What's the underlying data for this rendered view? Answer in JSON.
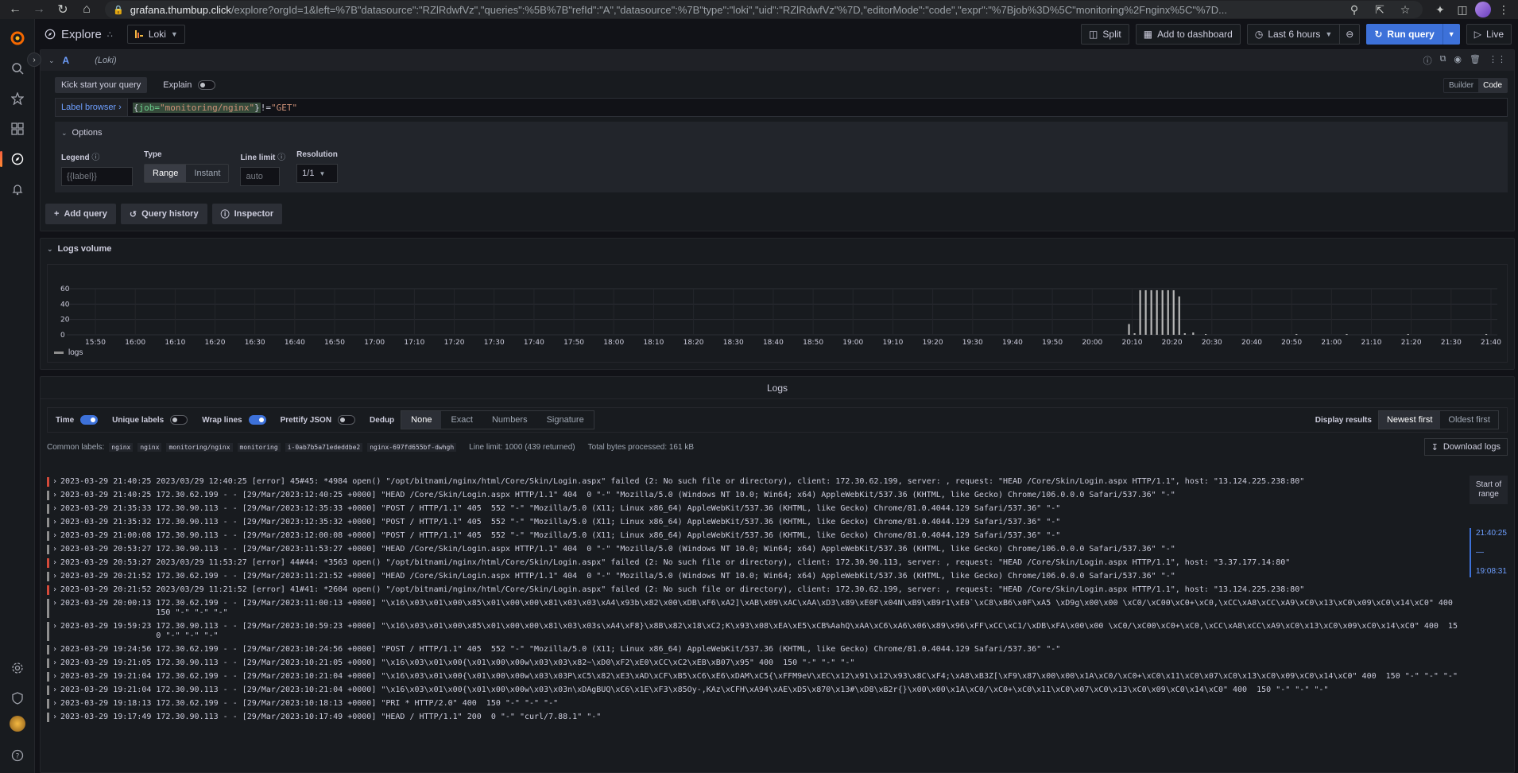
{
  "browser": {
    "url_domain": "grafana.thumbup.click",
    "url_path": "/explore?orgId=1&left=%7B\"datasource\":\"RZlRdwfVz\",\"queries\":%5B%7B\"refId\":\"A\",\"datasource\":%7B\"type\":\"loki\",\"uid\":\"RZlRdwfVz\"%7D,\"editorMode\":\"code\",\"expr\":\"%7Bjob%3D%5C\"monitoring%2Fnginx%5C\"%7D..."
  },
  "topbar": {
    "title": "Explore",
    "datasource": "Loki",
    "split": "Split",
    "add_to_dashboard": "Add to dashboard",
    "time_range": "Last 6 hours",
    "run_query": "Run query",
    "live": "Live"
  },
  "query": {
    "ref_id": "A",
    "ds_label": "(Loki)",
    "kick_start": "Kick start your query",
    "explain": "Explain",
    "builder": "Builder",
    "code": "Code",
    "label_browser": "Label browser ›",
    "expr_key": "job=",
    "expr_value": "\"monitoring/nginx\"",
    "expr_filter_op": " !=",
    "expr_filter_val": "\"GET\"",
    "options": {
      "title": "Options",
      "legend_label": "Legend",
      "legend_placeholder": "{{label}}",
      "type_label": "Type",
      "type_range": "Range",
      "type_instant": "Instant",
      "line_limit_label": "Line limit",
      "line_limit_placeholder": "auto",
      "resolution_label": "Resolution",
      "resolution_value": "1/1"
    },
    "add_query": "Add query",
    "query_history": "Query history",
    "inspector": "Inspector"
  },
  "logs_volume": {
    "title": "Logs volume",
    "legend": "logs"
  },
  "chart_data": {
    "type": "bar",
    "title": "",
    "xlabel": "",
    "ylabel": "",
    "ylim": [
      0,
      60
    ],
    "y_ticks": [
      "0",
      "20",
      "40",
      "60"
    ],
    "x_ticks": [
      "15:50",
      "16:00",
      "16:10",
      "16:20",
      "16:30",
      "16:40",
      "16:50",
      "17:00",
      "17:10",
      "17:20",
      "17:30",
      "17:40",
      "17:50",
      "18:00",
      "18:10",
      "18:20",
      "18:30",
      "18:40",
      "18:50",
      "19:00",
      "19:10",
      "19:20",
      "19:30",
      "19:40",
      "19:50",
      "20:00",
      "20:10",
      "20:20",
      "20:30",
      "20:40",
      "20:50",
      "21:00",
      "21:10",
      "21:20",
      "21:30",
      "21:40"
    ],
    "series": [
      {
        "name": "logs",
        "x": [
          0.74,
          0.744,
          0.748,
          0.752,
          0.756,
          0.76,
          0.764,
          0.768,
          0.772,
          0.776,
          0.78,
          0.786,
          0.795,
          0.86,
          0.896,
          0.94,
          0.996,
          1.015,
          1.026
        ],
        "values": [
          14,
          2,
          58,
          58,
          58,
          58,
          58,
          58,
          58,
          50,
          2,
          3,
          1,
          1,
          1,
          1,
          1,
          1,
          1
        ]
      }
    ]
  },
  "logs": {
    "title": "Logs",
    "opt_time": "Time",
    "opt_unique": "Unique labels",
    "opt_wrap": "Wrap lines",
    "opt_prettify": "Prettify JSON",
    "dedup_label": "Dedup",
    "dedup_none": "None",
    "dedup_exact": "Exact",
    "dedup_numbers": "Numbers",
    "dedup_signature": "Signature",
    "display_results": "Display results",
    "newest_first": "Newest first",
    "oldest_first": "Oldest first",
    "common_labels_label": "Common labels:",
    "common_labels": [
      "nginx",
      "nginx",
      "monitoring/nginx",
      "monitoring",
      "i-0ab7b5a71ededdbe2",
      "nginx-697fd655bf-dwhgh"
    ],
    "line_limit_text": "Line limit:  1000 (439 returned)",
    "bytes_text": "Total bytes processed:  161 kB",
    "download": "Download logs",
    "start_of_range": "Start of range",
    "range_top": "21:40:25",
    "range_sep": "—",
    "range_bottom": "19:08:31",
    "lines": [
      {
        "level": "err",
        "ts": "2023-03-29 21:40:25",
        "msg": "2023/03/29 12:40:25 [error] 45#45: *4984 open() \"/opt/bitnami/nginx/html/Core/Skin/Login.aspx\" failed (2: No such file or directory), client: 172.30.62.199, server: , request: \"HEAD /Core/Skin/Login.aspx HTTP/1.1\", host: \"13.124.225.238:80\""
      },
      {
        "level": "info",
        "ts": "2023-03-29 21:40:25",
        "msg": "172.30.62.199 - - [29/Mar/2023:12:40:25 +0000] \"HEAD /Core/Skin/Login.aspx HTTP/1.1\" 404  0 \"-\" \"Mozilla/5.0 (Windows NT 10.0; Win64; x64) AppleWebKit/537.36 (KHTML, like Gecko) Chrome/106.0.0.0 Safari/537.36\" \"-\""
      },
      {
        "level": "info",
        "ts": "2023-03-29 21:35:33",
        "msg": "172.30.90.113 - - [29/Mar/2023:12:35:33 +0000] \"POST / HTTP/1.1\" 405  552 \"-\" \"Mozilla/5.0 (X11; Linux x86_64) AppleWebKit/537.36 (KHTML, like Gecko) Chrome/81.0.4044.129 Safari/537.36\" \"-\""
      },
      {
        "level": "info",
        "ts": "2023-03-29 21:35:32",
        "msg": "172.30.90.113 - - [29/Mar/2023:12:35:32 +0000] \"POST / HTTP/1.1\" 405  552 \"-\" \"Mozilla/5.0 (X11; Linux x86_64) AppleWebKit/537.36 (KHTML, like Gecko) Chrome/81.0.4044.129 Safari/537.36\" \"-\""
      },
      {
        "level": "info",
        "ts": "2023-03-29 21:00:08",
        "msg": "172.30.90.113 - - [29/Mar/2023:12:00:08 +0000] \"POST / HTTP/1.1\" 405  552 \"-\" \"Mozilla/5.0 (X11; Linux x86_64) AppleWebKit/537.36 (KHTML, like Gecko) Chrome/81.0.4044.129 Safari/537.36\" \"-\""
      },
      {
        "level": "info",
        "ts": "2023-03-29 20:53:27",
        "msg": "172.30.90.113 - - [29/Mar/2023:11:53:27 +0000] \"HEAD /Core/Skin/Login.aspx HTTP/1.1\" 404  0 \"-\" \"Mozilla/5.0 (Windows NT 10.0; Win64; x64) AppleWebKit/537.36 (KHTML, like Gecko) Chrome/106.0.0.0 Safari/537.36\" \"-\""
      },
      {
        "level": "err",
        "ts": "2023-03-29 20:53:27",
        "msg": "2023/03/29 11:53:27 [error] 44#44: *3563 open() \"/opt/bitnami/nginx/html/Core/Skin/Login.aspx\" failed (2: No such file or directory), client: 172.30.90.113, server: , request: \"HEAD /Core/Skin/Login.aspx HTTP/1.1\", host: \"3.37.177.14:80\""
      },
      {
        "level": "info",
        "ts": "2023-03-29 20:21:52",
        "msg": "172.30.62.199 - - [29/Mar/2023:11:21:52 +0000] \"HEAD /Core/Skin/Login.aspx HTTP/1.1\" 404  0 \"-\" \"Mozilla/5.0 (Windows NT 10.0; Win64; x64) AppleWebKit/537.36 (KHTML, like Gecko) Chrome/106.0.0.0 Safari/537.36\" \"-\""
      },
      {
        "level": "err",
        "ts": "2023-03-29 20:21:52",
        "msg": "2023/03/29 11:21:52 [error] 41#41: *2604 open() \"/opt/bitnami/nginx/html/Core/Skin/Login.aspx\" failed (2: No such file or directory), client: 172.30.62.199, server: , request: \"HEAD /Core/Skin/Login.aspx HTTP/1.1\", host: \"13.124.225.238:80\""
      },
      {
        "level": "info",
        "ts": "2023-03-29 20:00:13",
        "msg": "172.30.62.199 - - [29/Mar/2023:11:00:13 +0000] \"\\x16\\x03\\x01\\x00\\x85\\x01\\x00\\x00\\x81\\x03\\x03\\xA4\\x93b\\x82\\x00\\xDB\\xF6\\xA2]\\xAB\\x09\\xAC\\xAA\\xD3\\x89\\xE0F\\x04N\\xB9\\xB9r1\\xE0`\\xC8\\xB6\\x0F\\xA5 \\xD9g\\x00\\x00 \\xC0/\\xC00\\xC0+\\xC0,\\xCC\\xA8\\xCC\\xA9\\xC0\\x13\\xC0\\x09\\xC0\\x14\\xC0\" 400  150 \"-\" \"-\" \"-\""
      },
      {
        "level": "info",
        "ts": "2023-03-29 19:59:23",
        "msg": "172.30.90.113 - - [29/Mar/2023:10:59:23 +0000] \"\\x16\\x03\\x01\\x00\\x85\\x01\\x00\\x00\\x81\\x03\\x03s\\xA4\\xF8}\\x8B\\x82\\x18\\xC2;K\\x93\\x08\\xEA\\xE5\\xCB%AahQ\\xAA\\xC6\\xA6\\x06\\x89\\x96\\xFF\\xCC\\xC1/\\xDB\\xFA\\x00\\x00 \\xC0/\\xC00\\xC0+\\xC0,\\xCC\\xA8\\xCC\\xA9\\xC0\\x13\\xC0\\x09\\xC0\\x14\\xC0\" 400  150 \"-\" \"-\" \"-\""
      },
      {
        "level": "info",
        "ts": "2023-03-29 19:24:56",
        "msg": "172.30.62.199 - - [29/Mar/2023:10:24:56 +0000] \"POST / HTTP/1.1\" 405  552 \"-\" \"Mozilla/5.0 (X11; Linux x86_64) AppleWebKit/537.36 (KHTML, like Gecko) Chrome/81.0.4044.129 Safari/537.36\" \"-\""
      },
      {
        "level": "info",
        "ts": "2023-03-29 19:21:05",
        "msg": "172.30.90.113 - - [29/Mar/2023:10:21:05 +0000] \"\\x16\\x03\\x01\\x00{\\x01\\x00\\x00w\\x03\\x03\\x82~\\xD0\\xF2\\xE0\\xCC\\xC2\\xEB\\xB07\\x95\" 400  150 \"-\" \"-\" \"-\""
      },
      {
        "level": "info",
        "ts": "2023-03-29 19:21:04",
        "msg": "172.30.62.199 - - [29/Mar/2023:10:21:04 +0000] \"\\x16\\x03\\x01\\x00{\\x01\\x00\\x00w\\x03\\x03P\\xC5\\x82\\xE3\\xAD\\xCF\\xB5\\xC6\\xE6\\xDAM\\xC5{\\xFFM9eV\\xEC\\x12\\x91\\x12\\x93\\x8C\\xF4;\\xA8\\xB3Z[\\xF9\\x87\\x00\\x00\\x1A\\xC0/\\xC0+\\xC0\\x11\\xC0\\x07\\xC0\\x13\\xC0\\x09\\xC0\\x14\\xC0\" 400  150 \"-\" \"-\" \"-\""
      },
      {
        "level": "info",
        "ts": "2023-03-29 19:21:04",
        "msg": "172.30.90.113 - - [29/Mar/2023:10:21:04 +0000] \"\\x16\\x03\\x01\\x00{\\x01\\x00\\x00w\\x03\\x03n\\xDAgBUQ\\xC6\\x1E\\xF3\\x85Oy-,KAz\\xCFH\\xA94\\xAE\\xD5\\x870\\x13#\\xD8\\xB2r{}\\x00\\x00\\x1A\\xC0/\\xC0+\\xC0\\x11\\xC0\\x07\\xC0\\x13\\xC0\\x09\\xC0\\x14\\xC0\" 400  150 \"-\" \"-\" \"-\""
      },
      {
        "level": "info",
        "ts": "2023-03-29 19:18:13",
        "msg": "172.30.62.199 - - [29/Mar/2023:10:18:13 +0000] \"PRI * HTTP/2.0\" 400  150 \"-\" \"-\" \"-\""
      },
      {
        "level": "info",
        "ts": "2023-03-29 19:17:49",
        "msg": "172.30.90.113 - - [29/Mar/2023:10:17:49 +0000] \"HEAD / HTTP/1.1\" 200  0 \"-\" \"curl/7.88.1\" \"-\""
      }
    ]
  }
}
